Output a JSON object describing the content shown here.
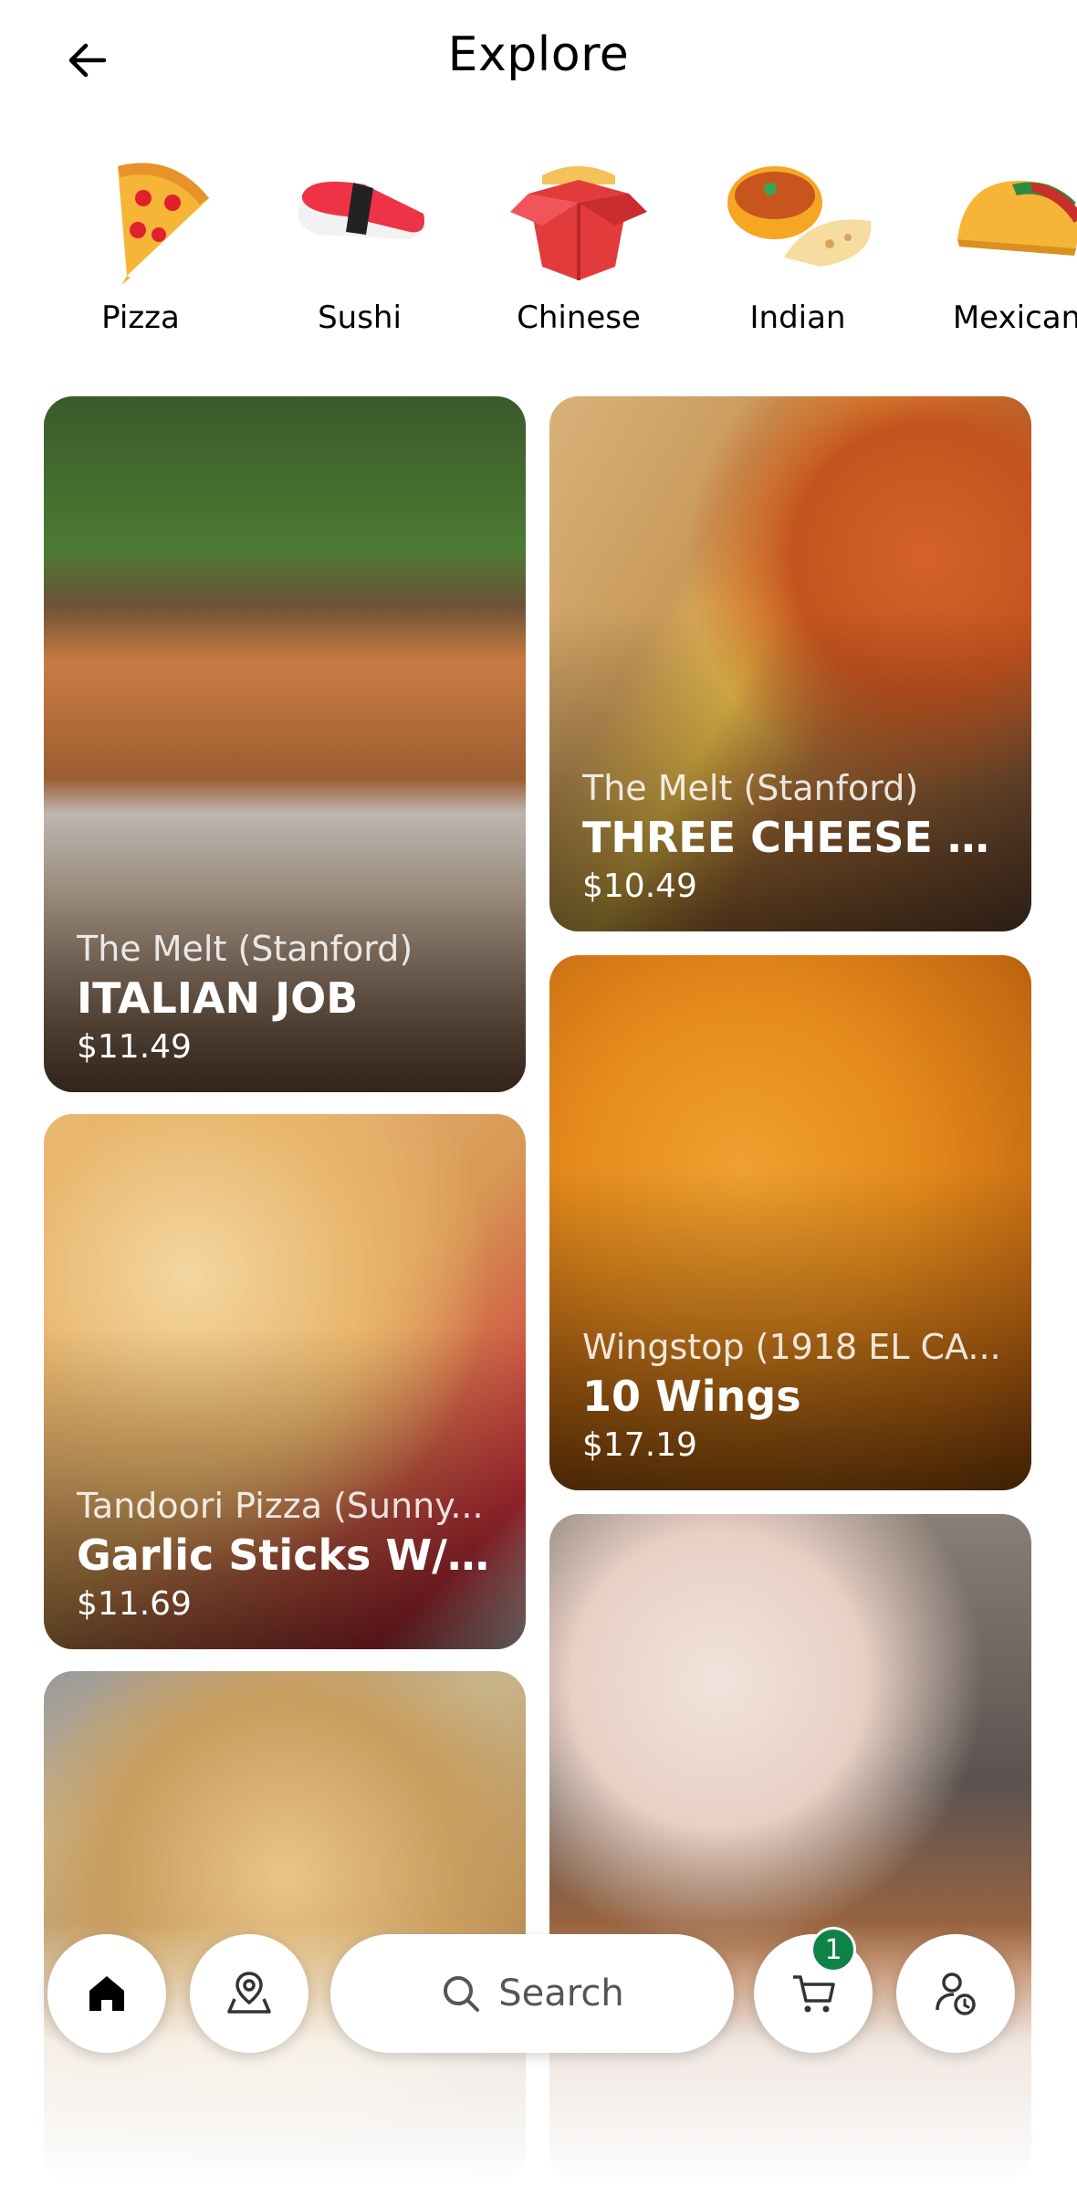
{
  "header": {
    "title": "Explore"
  },
  "categories": [
    {
      "label": "Pizza",
      "icon": "pizza-icon"
    },
    {
      "label": "Sushi",
      "icon": "sushi-icon"
    },
    {
      "label": "Chinese",
      "icon": "takeout-box-icon"
    },
    {
      "label": "Indian",
      "icon": "curry-naan-icon"
    },
    {
      "label": "Mexican",
      "icon": "taco-icon"
    }
  ],
  "feed": [
    {
      "store": "The Melt (Stanford)",
      "item": "ITALIAN JOB",
      "price": "$11.49"
    },
    {
      "store": "The Melt (Stanford)",
      "item": "THREE CHEESE CL...",
      "price": "$10.49"
    },
    {
      "store": "Tandoori Pizza (Sunny...",
      "item": "Garlic Sticks W/ C...",
      "price": "$11.69"
    },
    {
      "store": "Wingstop (1918 EL CA...",
      "item": "10 Wings",
      "price": "$17.19"
    },
    {
      "store": "",
      "item": "",
      "price": ""
    },
    {
      "store": "",
      "item": "",
      "price": ""
    }
  ],
  "nav": {
    "search_label": "Search",
    "cart_count": "1",
    "accent": "#0e8345"
  }
}
